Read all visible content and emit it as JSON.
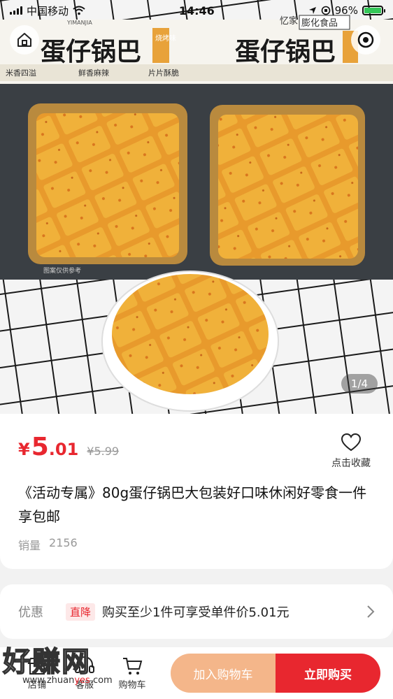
{
  "status_bar": {
    "carrier": "中国移动",
    "time": "14:46",
    "battery": "96%"
  },
  "gallery": {
    "page_indicator": "1/4",
    "package_brand": "忆家",
    "package_brand_sub": "YIMANJIA",
    "package_tag": "膨化食品",
    "package_title": "蛋仔锅巴",
    "package_flavor": "烧烤味",
    "package_features": [
      "米香四溢",
      "鲜香麻辣",
      "片片酥脆"
    ],
    "package_note": "图案仅供参考"
  },
  "product": {
    "currency": "¥",
    "price_integer": "5",
    "price_decimal": ".01",
    "original_price": "¥5.99",
    "favorite_label": "点击收藏",
    "title": "《活动专属》80g蛋仔锅巴大包装好口味休闲好零食一件享包邮",
    "sales_label": "销量",
    "sales_count": "2156"
  },
  "promo": {
    "label": "优惠",
    "badge": "直降",
    "text": "购买至少1件可享受单件价5.01元"
  },
  "bottom_bar": {
    "nav": [
      {
        "label": "店铺",
        "icon": "store-icon"
      },
      {
        "label": "客服",
        "icon": "customer-service-icon"
      },
      {
        "label": "购物车",
        "icon": "cart-icon"
      }
    ],
    "add_to_cart": "加入购物车",
    "buy_now": "立即购买"
  },
  "watermark": {
    "text": "好赚网",
    "url_pre": "www.zhuan",
    "url_accent": "yes",
    "url_post": ".com"
  },
  "colors": {
    "accent": "#e8272f",
    "cart_button": "#f4b68a",
    "battery": "#34c759"
  }
}
